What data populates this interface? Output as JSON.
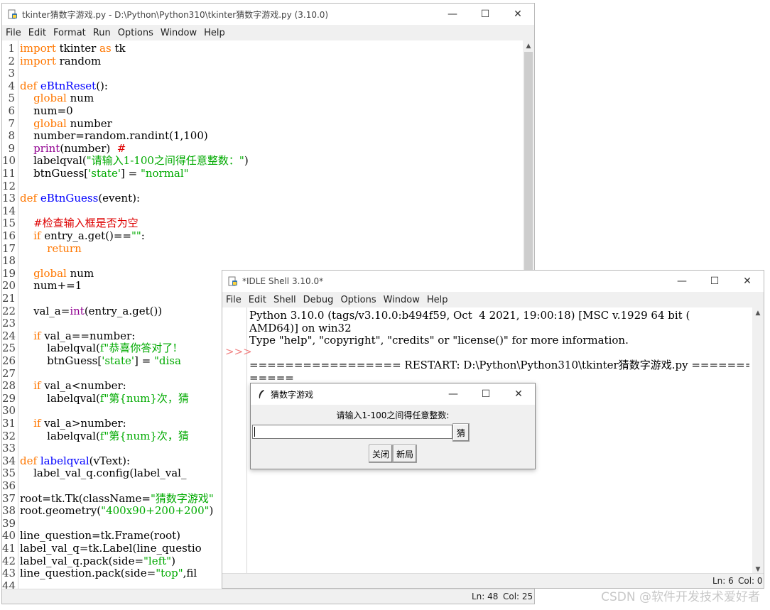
{
  "editor": {
    "title": "tkinter猜数字游戏.py - D:\\Python\\Python310\\tkinter猜数字游戏.py (3.10.0)",
    "menu": [
      "File",
      "Edit",
      "Format",
      "Run",
      "Options",
      "Window",
      "Help"
    ],
    "lines": [
      {
        "n": "1",
        "parts": [
          [
            "kw",
            "import"
          ],
          [
            "t",
            " tkinter "
          ],
          [
            "kw",
            "as"
          ],
          [
            "t",
            " tk"
          ]
        ]
      },
      {
        "n": "2",
        "parts": [
          [
            "kw",
            "import"
          ],
          [
            "t",
            " random"
          ]
        ]
      },
      {
        "n": "3",
        "parts": []
      },
      {
        "n": "4",
        "parts": [
          [
            "kw",
            "def"
          ],
          [
            "t",
            " "
          ],
          [
            "def",
            "eBtnReset"
          ],
          [
            "t",
            "():"
          ]
        ]
      },
      {
        "n": "5",
        "parts": [
          [
            "t",
            "    "
          ],
          [
            "kw",
            "global"
          ],
          [
            "t",
            " num"
          ]
        ]
      },
      {
        "n": "6",
        "parts": [
          [
            "t",
            "    num=0"
          ]
        ]
      },
      {
        "n": "7",
        "parts": [
          [
            "t",
            "    "
          ],
          [
            "kw",
            "global"
          ],
          [
            "t",
            " number"
          ]
        ]
      },
      {
        "n": "8",
        "parts": [
          [
            "t",
            "    number=random.randint(1,100)"
          ]
        ]
      },
      {
        "n": "9",
        "parts": [
          [
            "t",
            "    "
          ],
          [
            "bi",
            "print"
          ],
          [
            "t",
            "(number)  "
          ],
          [
            "cm",
            "#"
          ]
        ]
      },
      {
        "n": "10",
        "parts": [
          [
            "t",
            "    labelqval("
          ],
          [
            "str",
            "\"请输入1-100之间得任意整数：\""
          ],
          [
            "t",
            ")"
          ]
        ]
      },
      {
        "n": "11",
        "parts": [
          [
            "t",
            "    btnGuess["
          ],
          [
            "str",
            "'state'"
          ],
          [
            "t",
            "] = "
          ],
          [
            "str",
            "\"normal\""
          ]
        ]
      },
      {
        "n": "12",
        "parts": []
      },
      {
        "n": "13",
        "parts": [
          [
            "kw",
            "def"
          ],
          [
            "t",
            " "
          ],
          [
            "def",
            "eBtnGuess"
          ],
          [
            "t",
            "(event):"
          ]
        ]
      },
      {
        "n": "14",
        "parts": []
      },
      {
        "n": "15",
        "parts": [
          [
            "t",
            "    "
          ],
          [
            "cm",
            "#检查输入框是否为空"
          ]
        ]
      },
      {
        "n": "16",
        "parts": [
          [
            "t",
            "    "
          ],
          [
            "kw",
            "if"
          ],
          [
            "t",
            " entry_a.get()=="
          ],
          [
            "str",
            "\"\""
          ],
          [
            "t",
            ":"
          ]
        ]
      },
      {
        "n": "17",
        "parts": [
          [
            "t",
            "        "
          ],
          [
            "kw",
            "return"
          ]
        ]
      },
      {
        "n": "18",
        "parts": []
      },
      {
        "n": "19",
        "parts": [
          [
            "t",
            "    "
          ],
          [
            "kw",
            "global"
          ],
          [
            "t",
            " num"
          ]
        ]
      },
      {
        "n": "20",
        "parts": [
          [
            "t",
            "    num+=1"
          ]
        ]
      },
      {
        "n": "21",
        "parts": []
      },
      {
        "n": "22",
        "parts": [
          [
            "t",
            "    val_a="
          ],
          [
            "bi",
            "int"
          ],
          [
            "t",
            "(entry_a.get())"
          ]
        ]
      },
      {
        "n": "23",
        "parts": []
      },
      {
        "n": "24",
        "parts": [
          [
            "t",
            "    "
          ],
          [
            "kw",
            "if"
          ],
          [
            "t",
            " val_a==number:"
          ]
        ]
      },
      {
        "n": "25",
        "parts": [
          [
            "t",
            "        labelqval("
          ],
          [
            "str",
            "f\"恭喜你答对了!"
          ]
        ]
      },
      {
        "n": "26",
        "parts": [
          [
            "t",
            "        btnGuess["
          ],
          [
            "str",
            "'state'"
          ],
          [
            "t",
            "] = "
          ],
          [
            "str",
            "\"disa"
          ]
        ]
      },
      {
        "n": "27",
        "parts": []
      },
      {
        "n": "28",
        "parts": [
          [
            "t",
            "    "
          ],
          [
            "kw",
            "if"
          ],
          [
            "t",
            " val_a<number:"
          ]
        ]
      },
      {
        "n": "29",
        "parts": [
          [
            "t",
            "        labelqval("
          ],
          [
            "str",
            "f\"第{num}次，猜"
          ]
        ]
      },
      {
        "n": "30",
        "parts": []
      },
      {
        "n": "31",
        "parts": [
          [
            "t",
            "    "
          ],
          [
            "kw",
            "if"
          ],
          [
            "t",
            " val_a>number:"
          ]
        ]
      },
      {
        "n": "32",
        "parts": [
          [
            "t",
            "        labelqval("
          ],
          [
            "str",
            "f\"第{num}次，猜"
          ]
        ]
      },
      {
        "n": "33",
        "parts": []
      },
      {
        "n": "34",
        "parts": [
          [
            "kw",
            "def"
          ],
          [
            "t",
            " "
          ],
          [
            "def",
            "labelqval"
          ],
          [
            "t",
            "(vText):"
          ]
        ]
      },
      {
        "n": "35",
        "parts": [
          [
            "t",
            "    label_val_q.config(label_val_"
          ]
        ]
      },
      {
        "n": "36",
        "parts": []
      },
      {
        "n": "37",
        "parts": [
          [
            "t",
            "root=tk.Tk(className="
          ],
          [
            "str",
            "\"猜数字游戏\""
          ]
        ]
      },
      {
        "n": "38",
        "parts": [
          [
            "t",
            "root.geometry("
          ],
          [
            "str",
            "\"400x90+200+200\""
          ],
          [
            "t",
            ")"
          ]
        ]
      },
      {
        "n": "39",
        "parts": []
      },
      {
        "n": "40",
        "parts": [
          [
            "t",
            "line_question=tk.Frame(root)"
          ]
        ]
      },
      {
        "n": "41",
        "parts": [
          [
            "t",
            "label_val_q=tk.Label(line_questio"
          ]
        ]
      },
      {
        "n": "42",
        "parts": [
          [
            "t",
            "label_val_q.pack(side="
          ],
          [
            "str",
            "\"left\""
          ],
          [
            "t",
            ")"
          ]
        ]
      },
      {
        "n": "43",
        "parts": [
          [
            "t",
            "line_question.pack(side="
          ],
          [
            "str",
            "\"top\""
          ],
          [
            "t",
            ",fil"
          ]
        ]
      },
      {
        "n": "44",
        "parts": []
      }
    ],
    "status": {
      "ln": "Ln: 48",
      "col": "Col: 25"
    }
  },
  "shell": {
    "title": "*IDLE Shell 3.10.0*",
    "menu": [
      "File",
      "Edit",
      "Shell",
      "Debug",
      "Options",
      "Window",
      "Help"
    ],
    "prompt": ">>>",
    "lines": [
      "Python 3.10.0 (tags/v3.10.0:b494f59, Oct  4 2021, 19:00:18) [MSC v.1929 64 bit (",
      "AMD64)] on win32",
      "Type \"help\", \"copyright\", \"credits\" or \"license()\" for more information.",
      "",
      "================= RESTART: D:\\Python\\Python310\\tkinter猜数字游戏.py ============",
      "====="
    ],
    "status": {
      "ln": "Ln: 6",
      "col": "Col: 0"
    }
  },
  "tk_window": {
    "title": "猜数字游戏",
    "label": "请输入1-100之间得任意整数:",
    "entry_value": "",
    "guess_button": "猜",
    "close_button": "关闭",
    "new_button": "新局"
  },
  "watermark": "CSDN @软件开发技术爱好者",
  "colors": {
    "keyword": "#ff7700",
    "builtin": "#900090",
    "definition": "#0000ff",
    "string": "#00aa00",
    "comment": "#dd0000"
  }
}
